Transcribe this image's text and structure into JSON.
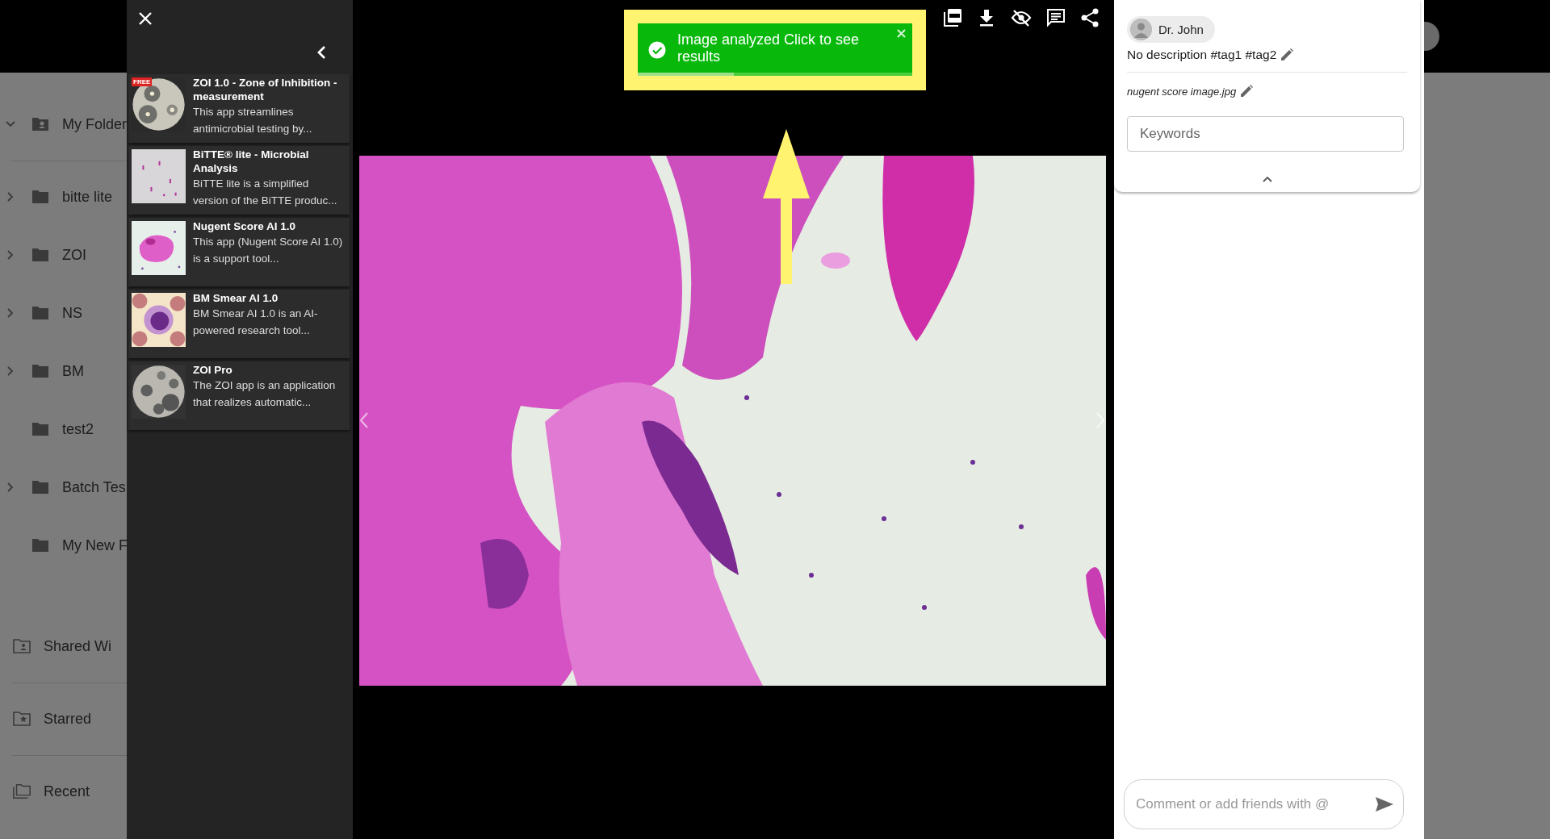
{
  "sidebar": {
    "items": [
      {
        "label": "My Folder",
        "kind": "my-folders",
        "expandable": true,
        "expanded": true
      },
      {
        "label": "bitte lite",
        "kind": "folder",
        "expandable": true,
        "expanded": false
      },
      {
        "label": "ZOI",
        "kind": "folder",
        "expandable": true,
        "expanded": false
      },
      {
        "label": "NS",
        "kind": "folder",
        "expandable": true,
        "expanded": false
      },
      {
        "label": "BM",
        "kind": "folder",
        "expandable": true,
        "expanded": false
      },
      {
        "label": "test2",
        "kind": "folder",
        "expandable": false
      },
      {
        "label": "Batch Tes",
        "kind": "folder",
        "expandable": true,
        "expanded": false
      },
      {
        "label": "My New F",
        "kind": "folder",
        "expandable": false
      },
      {
        "label": "Shared Wi",
        "kind": "shared",
        "expandable": false
      },
      {
        "label": "Starred",
        "kind": "starred",
        "expandable": false
      },
      {
        "label": "Recent",
        "kind": "recent",
        "expandable": false
      }
    ]
  },
  "app_panel": {
    "apps": [
      {
        "title": "ZOI 1.0 - Zone of Inhibition - measurement",
        "description": "This app streamlines antimicrobial testing by...",
        "badge": "FREE"
      },
      {
        "title": "BiTTE® lite - Microbial Analysis",
        "description": "BiTTE lite is a simplified version of the BiTTE produc..."
      },
      {
        "title": "Nugent Score AI 1.0",
        "description": "This app (Nugent Score AI 1.0) is a support tool..."
      },
      {
        "title": "BM Smear AI 1.0",
        "description": "BM Smear AI 1.0 is an AI-powered research tool..."
      },
      {
        "title": "ZOI Pro",
        "description": "The ZOI app is an application that realizes automatic..."
      }
    ]
  },
  "toast": {
    "message": "Image analyzed Click to see results",
    "level": 0.35
  },
  "details": {
    "owner": "Dr. John",
    "description": "No description #tag1 #tag2",
    "filename": "nugent score image.jpg",
    "keywords": {
      "placeholder": "Keywords"
    }
  },
  "comment": {
    "placeholder": "Comment or add friends with @"
  }
}
